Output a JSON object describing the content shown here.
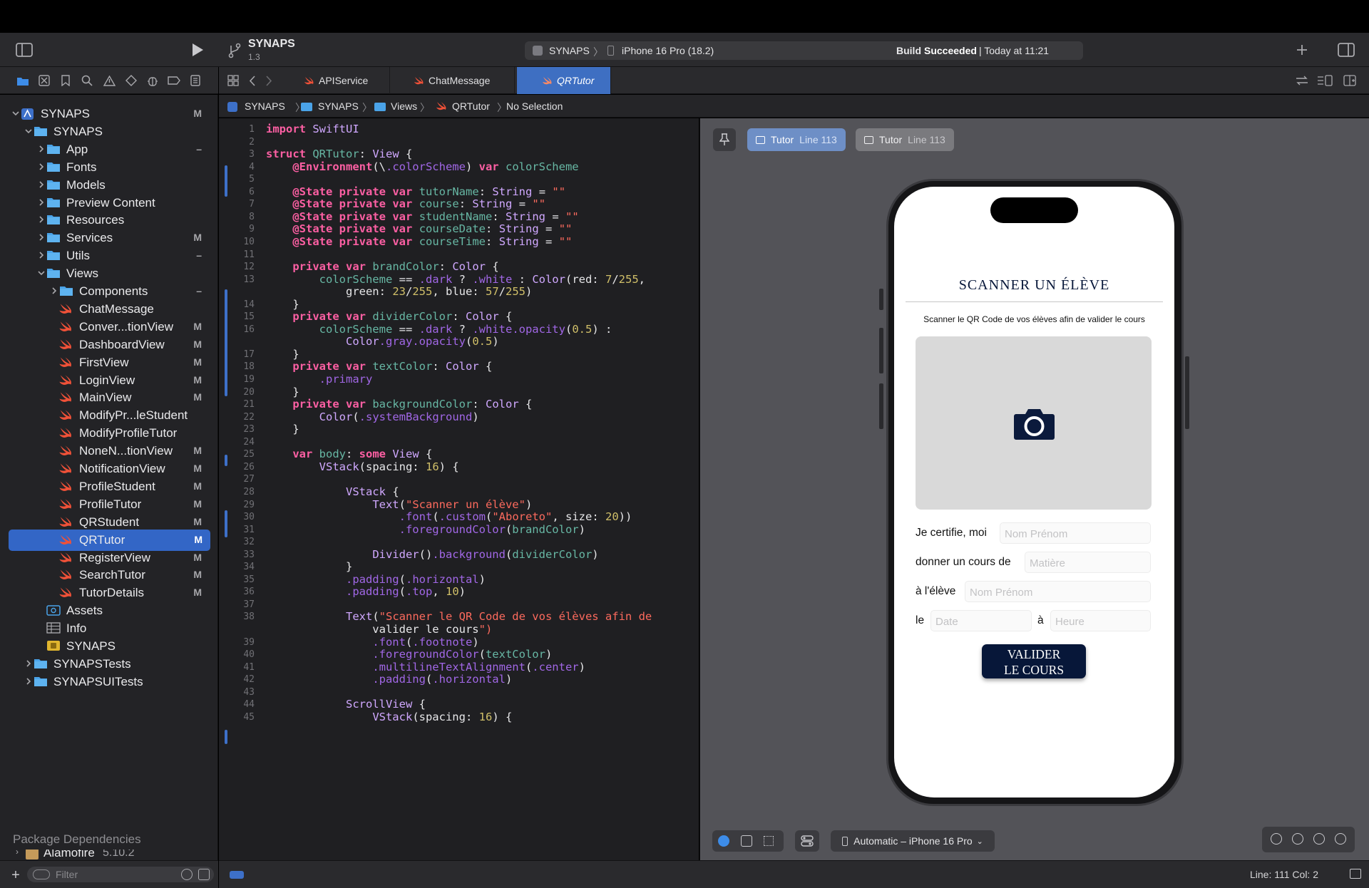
{
  "project": {
    "name": "SYNAPS",
    "version": "1.3"
  },
  "toolbar": {
    "scheme": "SYNAPS",
    "device": "iPhone 16 Pro (18.2)",
    "build_prefix": "Build ",
    "build_status": "Succeeded",
    "build_time": " | Today at 11:21"
  },
  "tabs": [
    {
      "label": "APIService"
    },
    {
      "label": "ChatMessage"
    },
    {
      "label": "QRTutor"
    }
  ],
  "breadcrumb": [
    "SYNAPS",
    "SYNAPS",
    "Views",
    "QRTutor",
    "No Selection"
  ],
  "navigator": {
    "items": [
      {
        "label": "SYNAPS",
        "status": "M"
      },
      {
        "label": "SYNAPS",
        "status": ""
      },
      {
        "label": "App",
        "status": "–"
      },
      {
        "label": "Fonts",
        "status": ""
      },
      {
        "label": "Models",
        "status": ""
      },
      {
        "label": "Preview Content",
        "status": ""
      },
      {
        "label": "Resources",
        "status": ""
      },
      {
        "label": "Services",
        "status": "M"
      },
      {
        "label": "Utils",
        "status": "–"
      },
      {
        "label": "Views",
        "status": ""
      },
      {
        "label": "Components",
        "status": "–"
      },
      {
        "label": "ChatMessage",
        "status": ""
      },
      {
        "label": "Conver...tionView",
        "status": "M"
      },
      {
        "label": "DashboardView",
        "status": "M"
      },
      {
        "label": "FirstView",
        "status": "M"
      },
      {
        "label": "LoginView",
        "status": "M"
      },
      {
        "label": "MainView",
        "status": "M"
      },
      {
        "label": "ModifyPr...leStudent",
        "status": ""
      },
      {
        "label": "ModifyProfileTutor",
        "status": ""
      },
      {
        "label": "NoneN...tionView",
        "status": "M"
      },
      {
        "label": "NotificationView",
        "status": "M"
      },
      {
        "label": "ProfileStudent",
        "status": "M"
      },
      {
        "label": "ProfileTutor",
        "status": "M"
      },
      {
        "label": "QRStudent",
        "status": "M"
      },
      {
        "label": "QRTutor",
        "status": "M"
      },
      {
        "label": "RegisterView",
        "status": "M"
      },
      {
        "label": "SearchTutor",
        "status": "M"
      },
      {
        "label": "TutorDetails",
        "status": "M"
      },
      {
        "label": "Assets",
        "status": ""
      },
      {
        "label": "Info",
        "status": ""
      },
      {
        "label": "SYNAPS",
        "status": ""
      },
      {
        "label": "SYNAPSTests",
        "status": ""
      },
      {
        "label": "SYNAPSUITests",
        "status": ""
      }
    ],
    "package_header": "Package Dependencies",
    "package": {
      "name": "Alamofire",
      "version": "5.10.2"
    },
    "filter_placeholder": "Filter"
  },
  "editor": {
    "line_numbers": [
      "1",
      "2",
      "3",
      "4",
      "5",
      "6",
      "7",
      "8",
      "9",
      "10",
      "11",
      "12",
      "13",
      "",
      "14",
      "15",
      "16",
      "",
      "17",
      "18",
      "19",
      "20",
      "21",
      "22",
      "23",
      "24",
      "25",
      "26",
      "27",
      "28",
      "29",
      "30",
      "31",
      "32",
      "33",
      "34",
      "35",
      "36",
      "37",
      "38",
      "",
      "39",
      "40",
      "41",
      "42",
      "43",
      "44",
      "45"
    ],
    "lines": [
      "import SwiftUI",
      "",
      "struct QRTutor: View {",
      "    @Environment(\\.colorScheme) var colorScheme",
      "",
      "    @State private var tutorName: String = \"\"",
      "    @State private var course: String = \"\"",
      "    @State private var studentName: String = \"\"",
      "    @State private var courseDate: String = \"\"",
      "    @State private var courseTime: String = \"\"",
      "",
      "    private var brandColor: Color {",
      "        colorScheme == .dark ? .white : Color(red: 7/255,",
      "            green: 23/255, blue: 57/255)",
      "    }",
      "    private var dividerColor: Color {",
      "        colorScheme == .dark ? .white.opacity(0.5) :",
      "            Color.gray.opacity(0.5)",
      "    }",
      "    private var textColor: Color {",
      "        .primary",
      "    }",
      "    private var backgroundColor: Color {",
      "        Color(.systemBackground)",
      "    }",
      "",
      "    var body: some View {",
      "        VStack(spacing: 16) {",
      "",
      "            VStack {",
      "                Text(\"Scanner un élève\")",
      "                    .font(.custom(\"Aboreto\", size: 20))",
      "                    .foregroundColor(brandColor)",
      "",
      "                Divider().background(dividerColor)",
      "            }",
      "            .padding(.horizontal)",
      "            .padding(.top, 10)",
      "",
      "            Text(\"Scanner le QR Code de vos élèves afin de",
      "                valider le cours\")",
      "                .font(.footnote)",
      "                .foregroundColor(textColor)",
      "                .multilineTextAlignment(.center)",
      "                .padding(.horizontal)",
      "",
      "            ScrollView {",
      "                VStack(spacing: 16) {"
    ]
  },
  "canvas": {
    "pins": [
      {
        "name": "Tutor",
        "line": "Line 113"
      },
      {
        "name": "Tutor",
        "line": "Line 113"
      }
    ],
    "device_selector": "Automatic – iPhone 16 Pro"
  },
  "preview": {
    "title": "SCANNER UN ÉLÈVE",
    "subtitle": "Scanner le QR Code de vos élèves afin de valider le cours",
    "certify_label": "Je certifie, moi",
    "tutor_placeholder": "Nom Prénom",
    "course_label": "donner un cours de",
    "course_placeholder": "Matière",
    "student_label": "à l'élève",
    "student_placeholder": "Nom Prénom",
    "date_label": "le",
    "date_placeholder": "Date",
    "time_label": "à",
    "time_placeholder": "Heure",
    "button_line1": "VALIDER",
    "button_line2": "LE COURS"
  },
  "status_bar": {
    "position": "Line: 111  Col: 2"
  },
  "colors": {
    "accent": "#3366c6",
    "brand": "#071739",
    "folder": "#4aa3e8",
    "swift": "#f05138"
  }
}
